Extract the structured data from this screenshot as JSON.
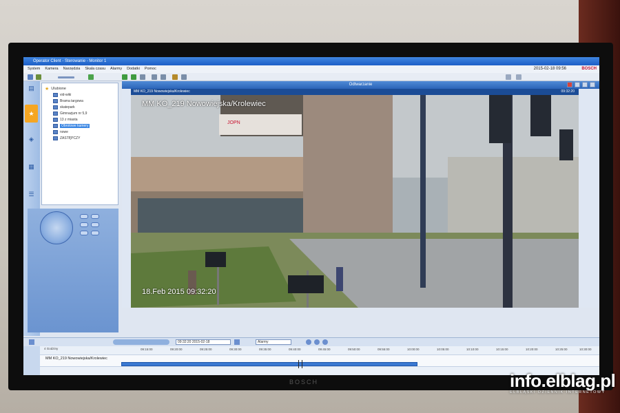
{
  "window": {
    "title": "Operator Client - Sterowanie - Monitor 1",
    "datetime": "2015-02-18 09:56",
    "brand": "BOSCH"
  },
  "menu": [
    "System",
    "Kamera",
    "Narzędzia",
    "Skala czasu",
    "Alarmy",
    "Dodatki",
    "Pomoc"
  ],
  "tree": {
    "root_label": "Ulubione",
    "items": [
      {
        "label": "vid-wiki",
        "selected": false
      },
      {
        "label": "Brama targowa",
        "selected": false
      },
      {
        "label": "skatepark",
        "selected": false
      },
      {
        "label": "Gimnazjum nr 5,9",
        "selected": false
      },
      {
        "label": "13 z miasta",
        "selected": false
      },
      {
        "label": "Obrotowe kamery",
        "selected": true
      },
      {
        "label": "nowe",
        "selected": false
      },
      {
        "label": "ZASTĘPCZY",
        "selected": false
      }
    ]
  },
  "video": {
    "header": "Odtwarzanie",
    "strip_label": "MM KO_219 Nowowiejska/Krolewiec",
    "strip_time": "09:32:20",
    "osd_name": "MM KO_219 Nowowiejska/Krolewiec",
    "osd_time": "18.Feb 2015  09:32:20",
    "sign_text": "JOPN"
  },
  "timeline": {
    "date_field": "09:32:20  2015-02-18",
    "alarm_select": "Alarmy",
    "hours_label": "4 Godziny",
    "camera_label": "MM KO_219 Nowowiejska/Krolewiec",
    "ticks": [
      "09:15:00",
      "09:20:00",
      "09:25:00",
      "09:30:00",
      "09:35:00",
      "09:40:00",
      "09:45:00",
      "09:50:00",
      "09:55:00",
      "10:00:00",
      "10:05:00",
      "10:10:00",
      "10:15:00",
      "10:20:00",
      "10:25:00",
      "10:30:00"
    ]
  },
  "bezel": {
    "brand": "BOSCH"
  },
  "watermark": {
    "main": "info.elblag.pl",
    "sub": "ELBLĄSKI DZIENNIK INTERNETOWY"
  },
  "colors": {
    "titlebar": "#1c5ec7",
    "selection": "#3a86e3",
    "bosch_red": "#c8102e"
  }
}
